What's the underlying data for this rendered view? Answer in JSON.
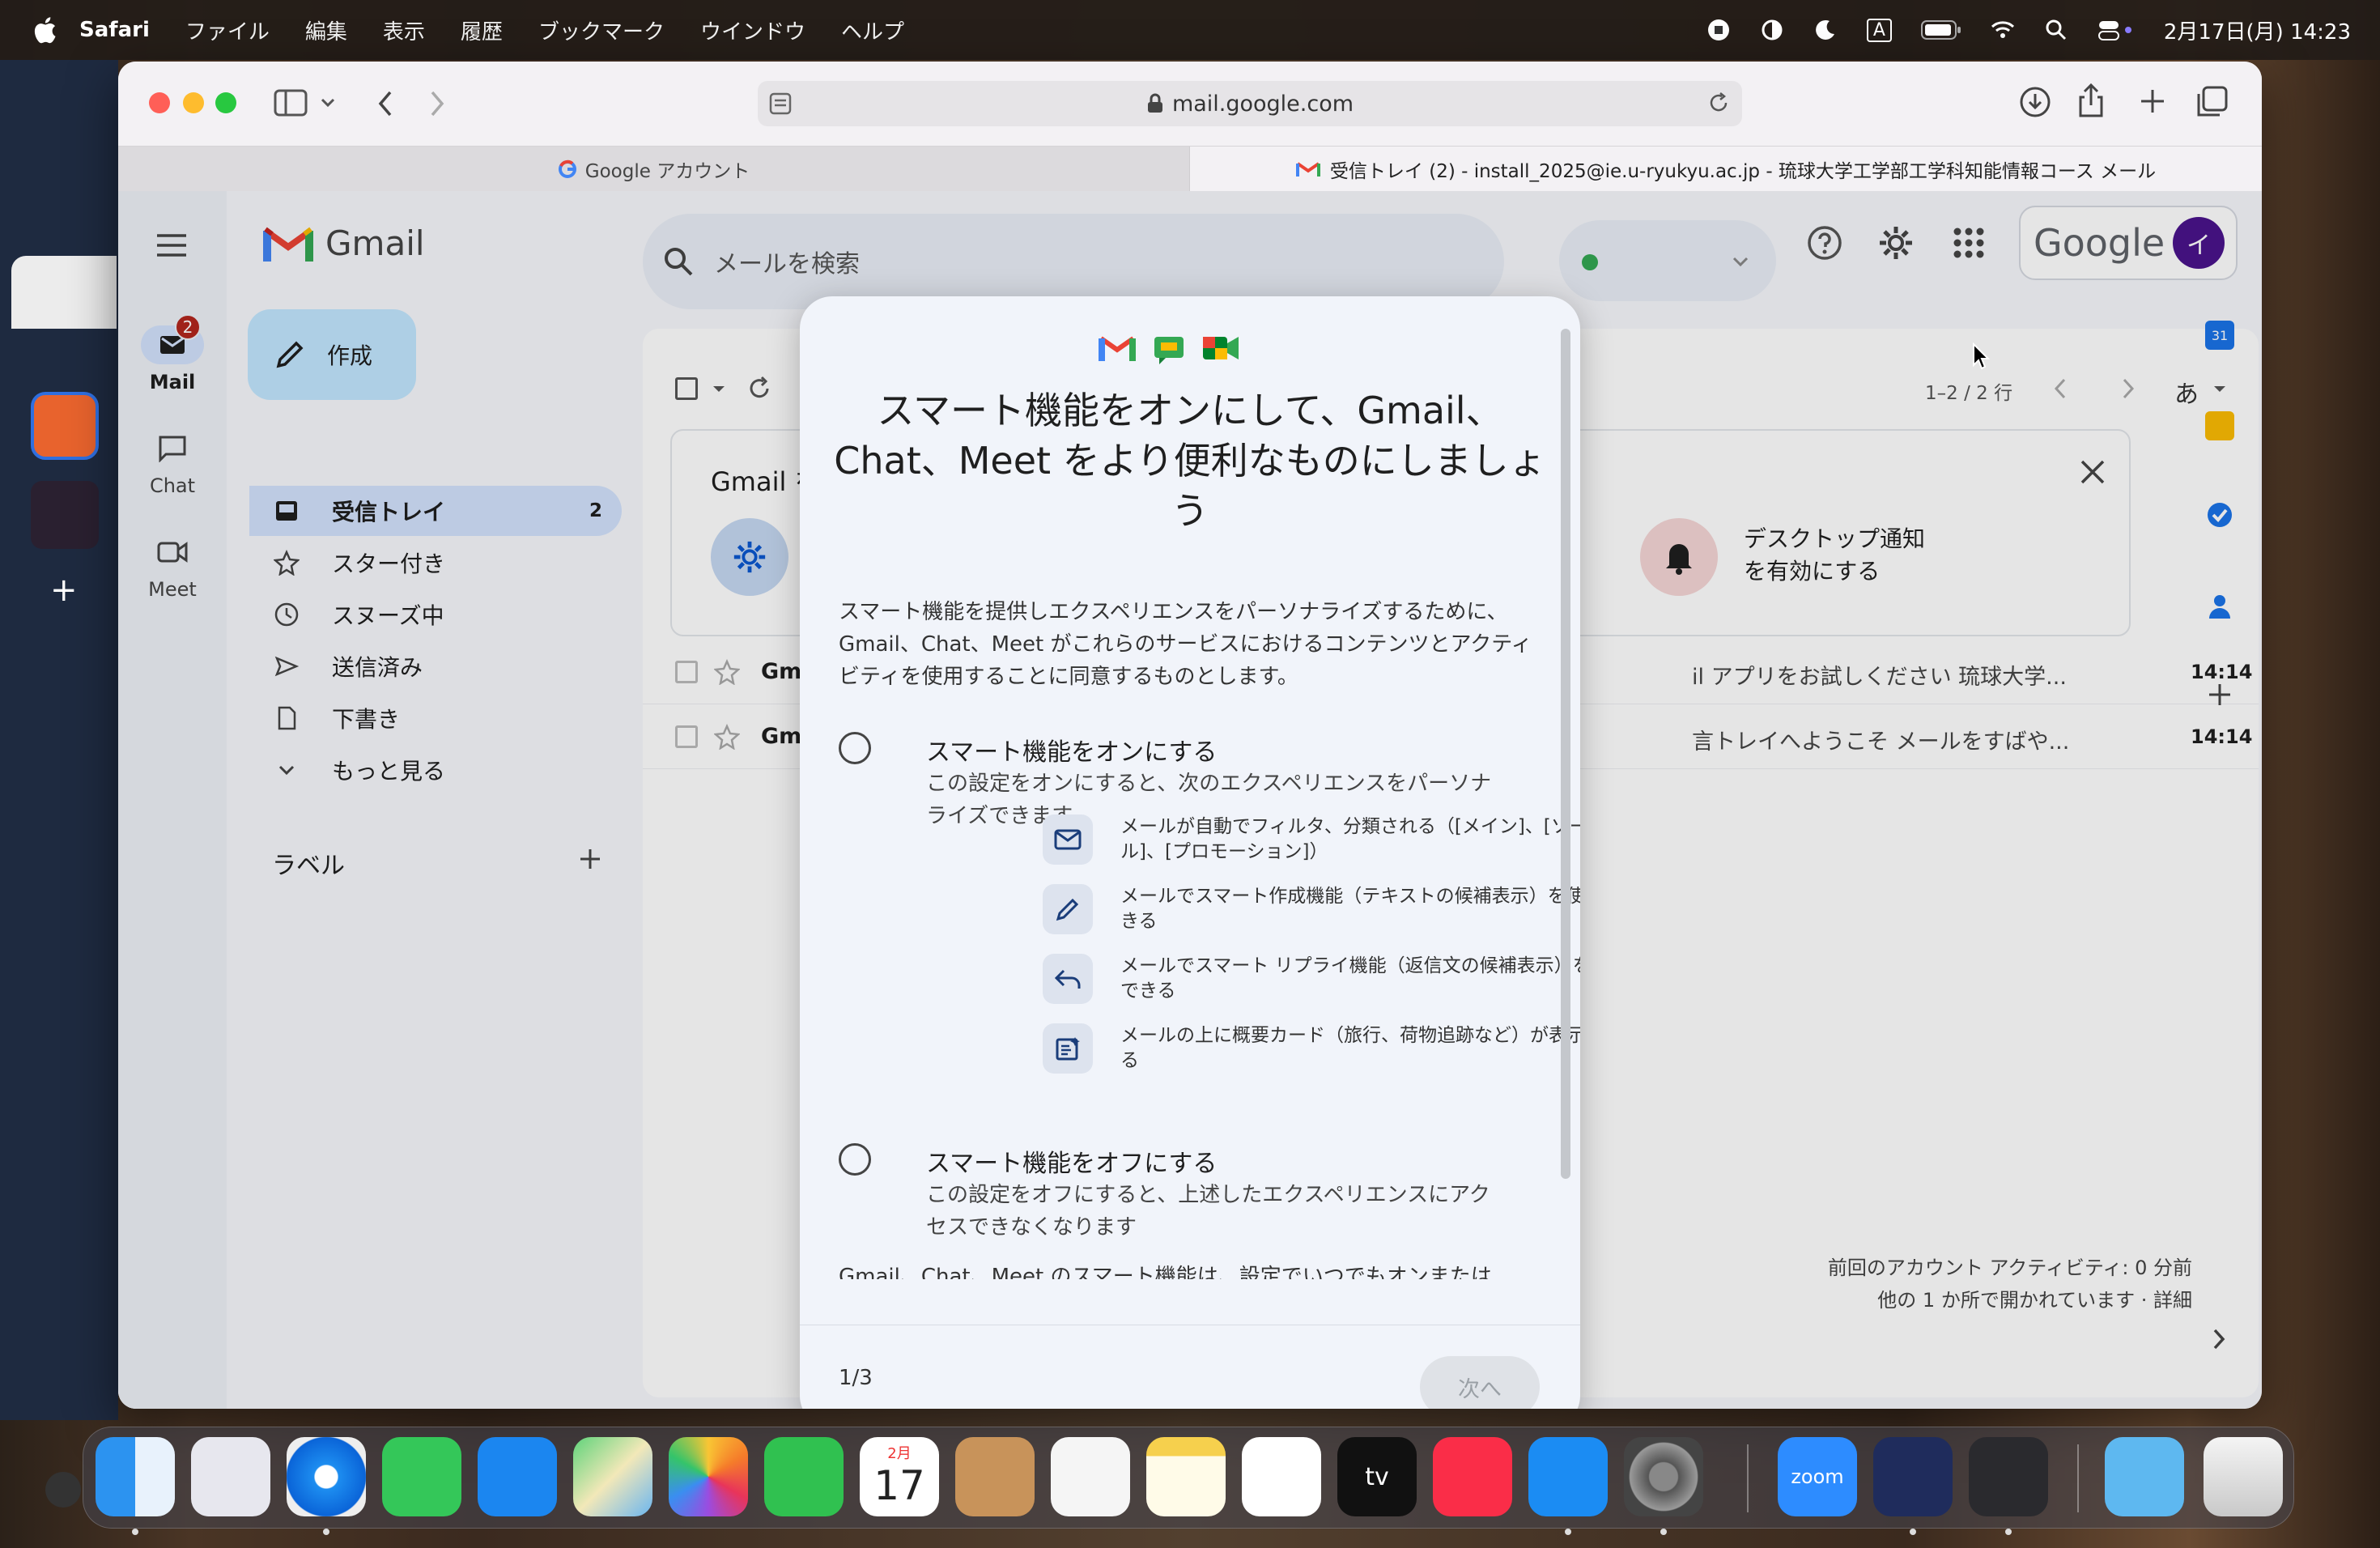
{
  "menubar": {
    "app": "Safari",
    "items": [
      "ファイル",
      "編集",
      "表示",
      "履歴",
      "ブックマーク",
      "ウインドウ",
      "ヘルプ"
    ],
    "datetime": "2月17日(月) 14:23",
    "input_mode": "A"
  },
  "safari": {
    "url": "mail.google.com",
    "tabs": [
      {
        "label": "Google アカウント",
        "active": false
      },
      {
        "label": "受信トレイ (2) - install_2025@ie.u-ryukyu.ac.jp - 琉球大学工学部工学科知能情報コース メール",
        "active": true
      }
    ]
  },
  "gmail": {
    "logo_text": "Gmail",
    "search_placeholder": "メールを検索",
    "google_logo": "Google",
    "avatar_initial": "イ",
    "rail": [
      {
        "label": "Mail",
        "badge": "2"
      },
      {
        "label": "Chat"
      },
      {
        "label": "Meet"
      }
    ],
    "compose_label": "作成",
    "nav": [
      {
        "label": "受信トレイ",
        "count": "2"
      },
      {
        "label": "スター付き"
      },
      {
        "label": "スヌーズ中"
      },
      {
        "label": "送信済み"
      },
      {
        "label": "下書き"
      },
      {
        "label": "もっと見る"
      }
    ],
    "labels_header": "ラベル",
    "pagination": "1–2 / 2 行",
    "input_tool": "あ",
    "banner_title": "Gmail を",
    "banner_notify": [
      "デスクトップ通知",
      "を有効にする"
    ],
    "emails": [
      {
        "sender": "Gm",
        "snippet": "il アプリをお試しください 琉球大学...",
        "time": "14:14"
      },
      {
        "sender": "Gm",
        "snippet": "言トレイへようこそ メールをすばや...",
        "time": "14:14"
      }
    ],
    "activity": [
      "前回のアカウント アクティビティ: 0 分前",
      "他の 1 か所で開かれています · 詳細"
    ]
  },
  "modal": {
    "title": "スマート機能をオンにして、Gmail、Chat、Meet をより便利なものにしましょう",
    "description": "スマート機能を提供しエクスペリエンスをパーソナライズするために、Gmail、Chat、Meet がこれらのサービスにおけるコンテンツとアクティビティを使用することに同意するものとします。",
    "option_on": {
      "title": "スマート機能をオンにする",
      "sub": "この設定をオンにすると、次のエクスペリエンスをパーソナライズできます。"
    },
    "features": [
      {
        "icon": "mail-icon",
        "text": "メールが自動でフィルタ、分類される（[メイン]、[ソーシャル]、[プロモーション]）"
      },
      {
        "icon": "pencil-icon",
        "text": "メールでスマート作成機能（テキストの候補表示）を使用できる"
      },
      {
        "icon": "reply-icon",
        "text": "メールでスマート リプライ機能（返信文の候補表示）を使用できる"
      },
      {
        "icon": "summary-card-icon",
        "text": "メールの上に概要カード（旅行、荷物追跡など）が表示される"
      }
    ],
    "option_off": {
      "title": "スマート機能をオフにする",
      "sub": "この設定をオフにすると、上述したエクスペリエンスにアクセスできなくなります"
    },
    "cutoff_text": "Gmail、Chat、Meet のスマート機能は、設定でいつでもオンまたは",
    "step": "1/3",
    "next_label": "次へ"
  },
  "dock": {
    "calendar_month": "2月",
    "calendar_day": "17",
    "zoom_label": "zoom"
  }
}
